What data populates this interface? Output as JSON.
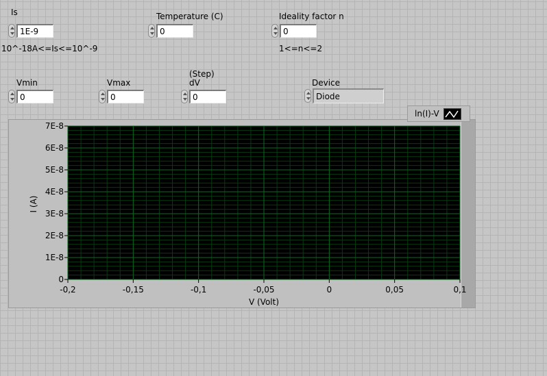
{
  "controls": {
    "is": {
      "label": "Is",
      "value": "1E-9",
      "range_note": "10^-18A<=Is<=10^-9"
    },
    "temperature": {
      "label": "Temperature (C)",
      "value": "0"
    },
    "ideality": {
      "label": "Ideality factor n",
      "value": "0",
      "range_note": "1<=n<=2"
    },
    "vmin": {
      "label": "Vmin",
      "value": "0"
    },
    "vmax": {
      "label": "Vmax",
      "value": "0"
    },
    "dv": {
      "label": "dV",
      "caption": "(Step)",
      "value": "0"
    },
    "device": {
      "label": "Device",
      "value": "Diode"
    }
  },
  "legend": {
    "label": "ln(I)-V",
    "icon": "line-plot-icon"
  },
  "colors": {
    "plot_bg": "#000000",
    "grid_major": "#0b6b1f",
    "grid_minor": "#083a12",
    "panel_bg": "#c6c6c6"
  },
  "chart_data": {
    "type": "line",
    "xlabel": "V (Volt)",
    "ylabel": "I (A)",
    "xlim": [
      -0.2,
      0.1
    ],
    "ylim": [
      0,
      7e-08
    ],
    "x_ticks": [
      -0.2,
      -0.15,
      -0.1,
      -0.05,
      0,
      0.05,
      0.1
    ],
    "x_tick_labels": [
      "-0,2",
      "-0,15",
      "-0,1",
      "-0,05",
      "0",
      "0,05",
      "0,1"
    ],
    "y_ticks": [
      0,
      1e-08,
      2e-08,
      3e-08,
      4e-08,
      5e-08,
      6e-08,
      7e-08
    ],
    "y_tick_labels": [
      "0",
      "1E-8",
      "2E-8",
      "3E-8",
      "4E-8",
      "5E-8",
      "6E-8",
      "7E-8"
    ],
    "grid": true,
    "series": []
  }
}
